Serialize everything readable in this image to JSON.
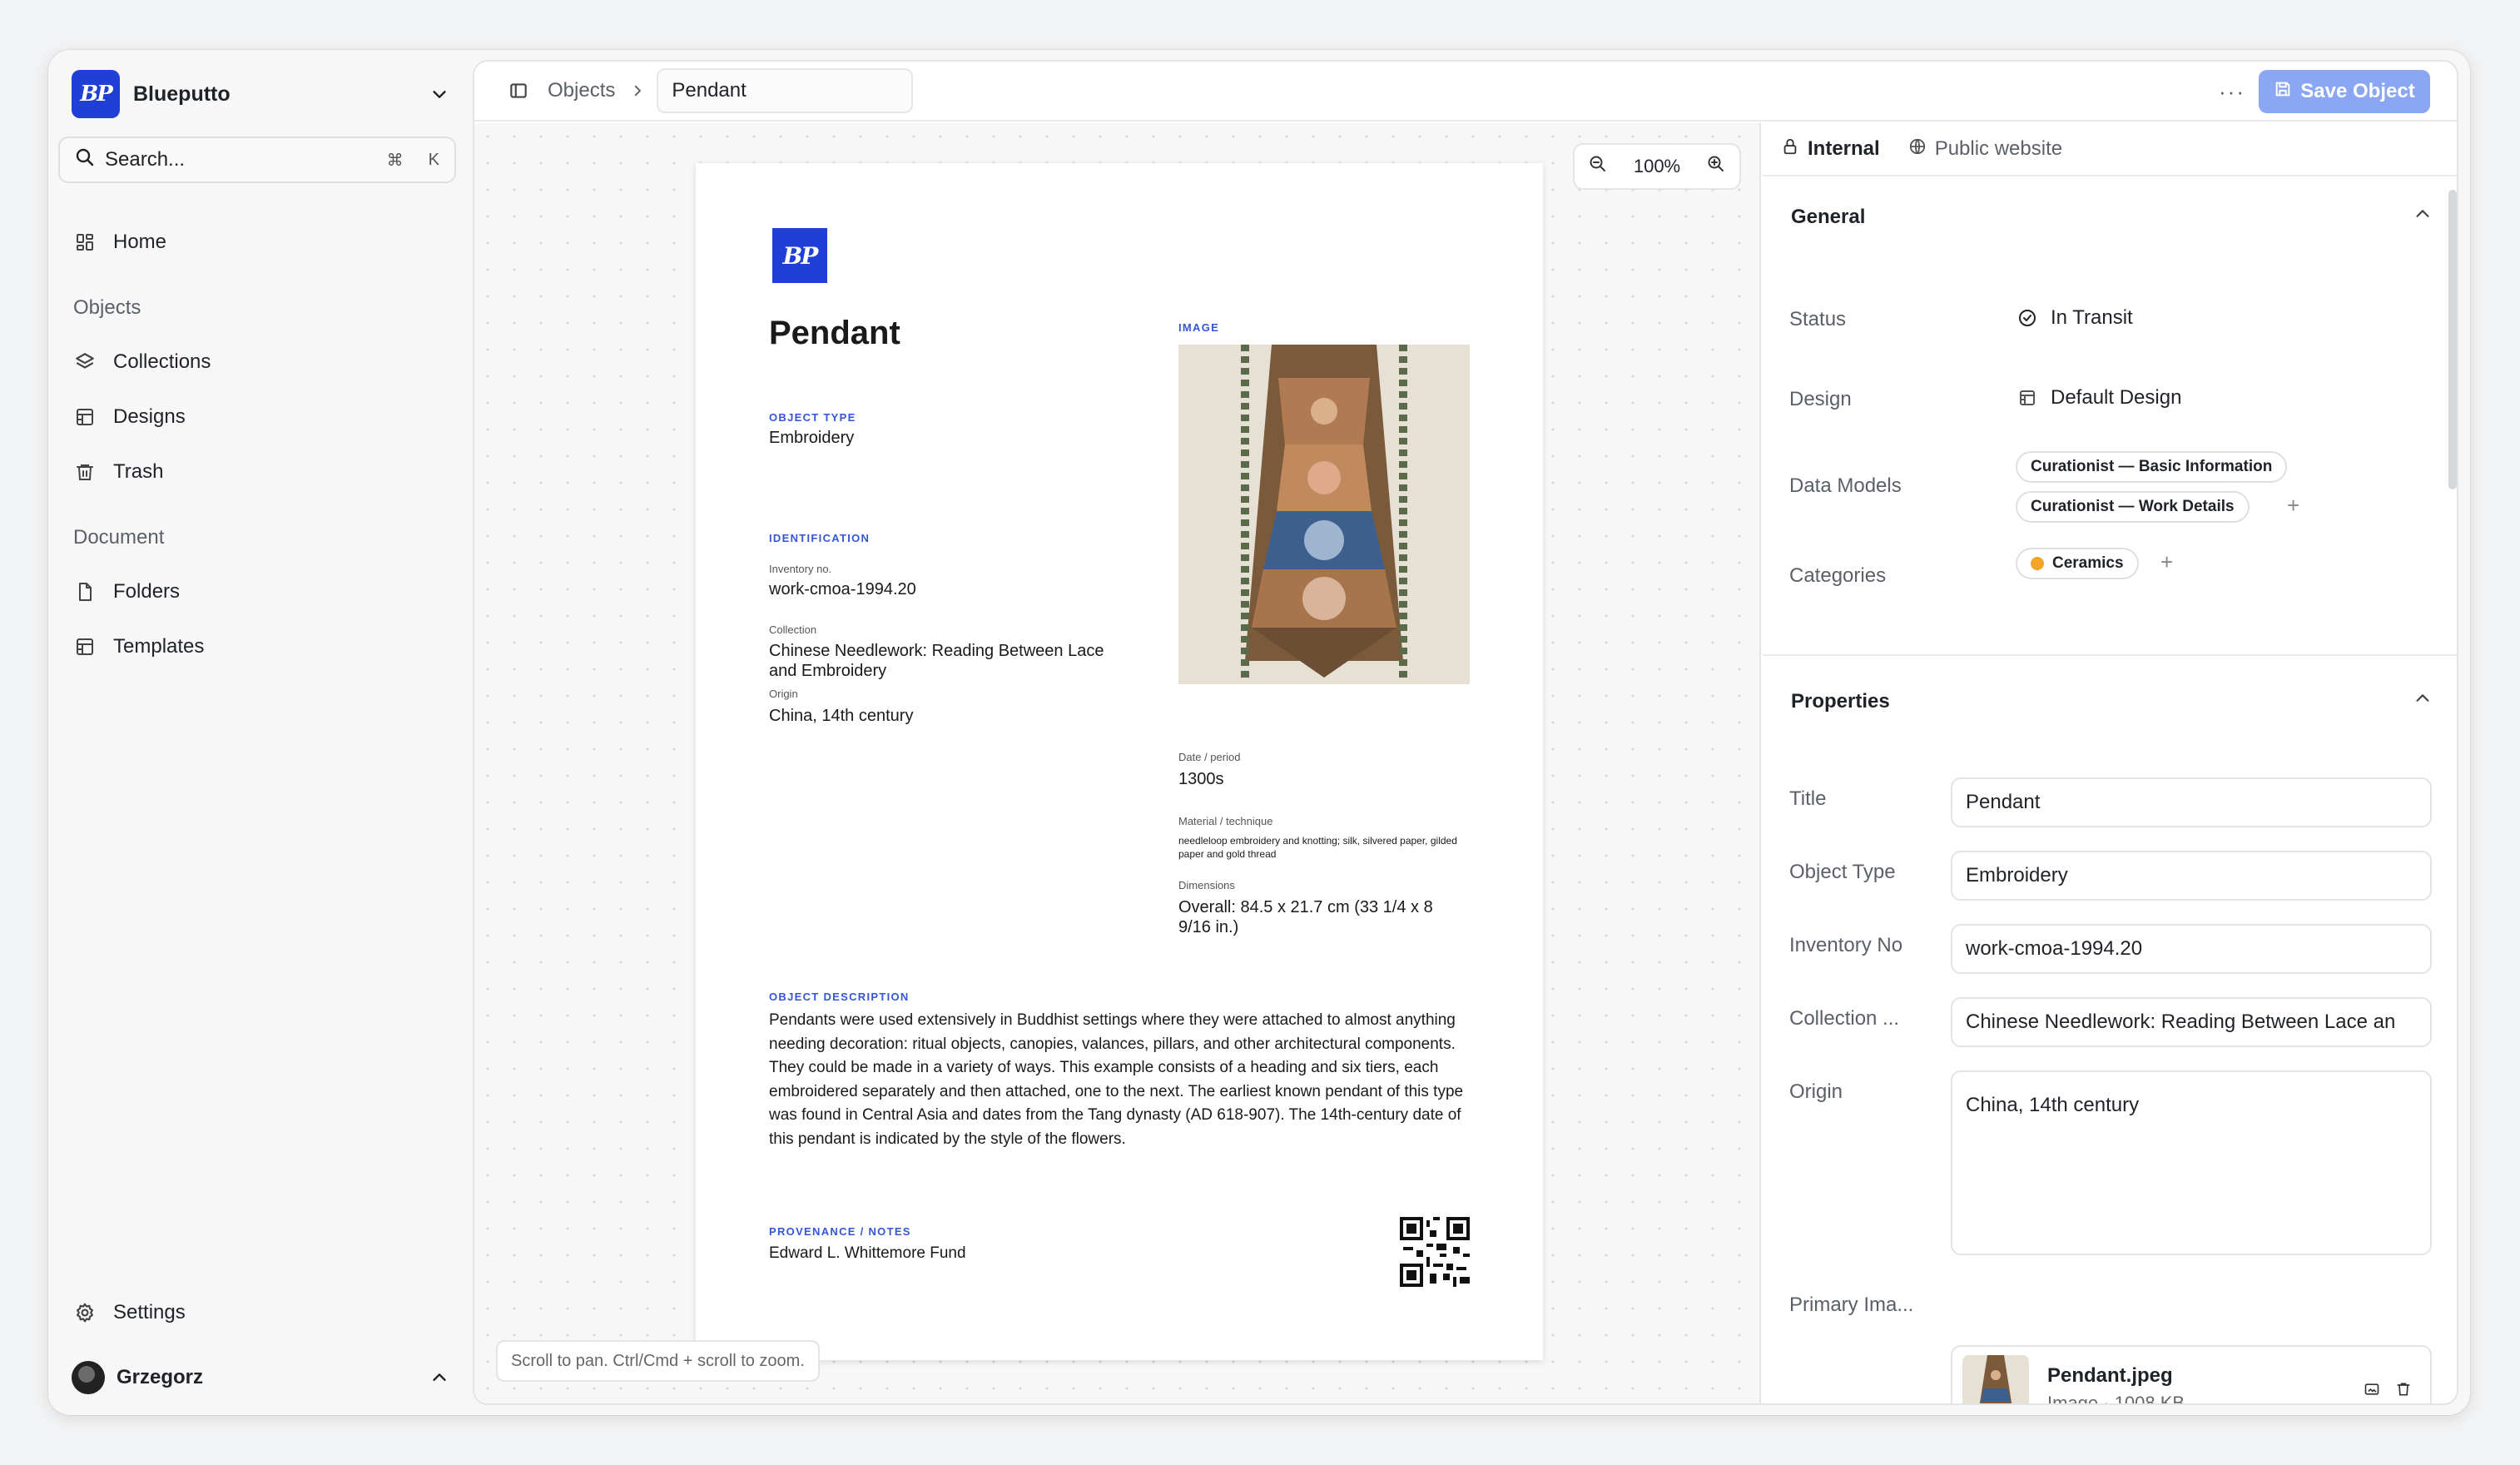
{
  "workspace": {
    "name": "Blueputto",
    "logo_text": "BP"
  },
  "search": {
    "label": "Search...",
    "shortcut_cmd": "⌘",
    "shortcut_key": "K"
  },
  "sidebar": {
    "home": "Home",
    "objects_section": "Objects",
    "collections": "Collections",
    "designs": "Designs",
    "trash": "Trash",
    "document_section": "Document",
    "folders": "Folders",
    "templates": "Templates",
    "settings": "Settings",
    "user": "Grzegorz"
  },
  "topbar": {
    "crumb_parent": "Objects",
    "crumb_current": "Pendant",
    "save_label": "Save Object"
  },
  "canvas": {
    "zoom_level": "100%",
    "hint": "Scroll to pan. Ctrl/Cmd + scroll to zoom."
  },
  "document": {
    "title": "Pendant",
    "image_label": "IMAGE",
    "object_type_label": "OBJECT TYPE",
    "object_type": "Embroidery",
    "identification_label": "IDENTIFICATION",
    "inventory_label": "Inventory no.",
    "inventory": "work-cmoa-1994.20",
    "collection_label": "Collection",
    "collection": "Chinese Needlework: Reading Between Lace and Embroidery",
    "origin_label": "Origin",
    "origin": "China, 14th century",
    "date_label": "Date / period",
    "date": "1300s",
    "material_label": "Material / technique",
    "material": "needleloop embroidery and knotting; silk, silvered paper, gilded paper and gold thread",
    "dimensions_label": "Dimensions",
    "dimensions": "Overall: 84.5 x 21.7 cm (33 1/4 x 8 9/16 in.)",
    "description_label": "OBJECT DESCRIPTION",
    "description": "Pendants were used extensively in Buddhist settings where they were attached to almost anything needing decoration: ritual objects, canopies, valances, pillars, and other architectural components. They could be made in a variety of ways. This example consists of a heading and six tiers, each embroidered separately and then attached, one to the next. The earliest known pendant of this type was found in Central Asia and dates from the Tang dynasty (AD 618-907). The 14th-century date of this pendant is indicated by the style of the flowers.",
    "provenance_label": "PROVENANCE / NOTES",
    "provenance": "Edward L. Whittemore Fund"
  },
  "inspector": {
    "tab_internal": "Internal",
    "tab_public": "Public website",
    "general_title": "General",
    "status_label": "Status",
    "status_value": "In Transit",
    "design_label": "Design",
    "design_value": "Default Design",
    "data_models_label": "Data Models",
    "data_model_1": "Curationist — Basic Information",
    "data_model_2": "Curationist — Work Details",
    "categories_label": "Categories",
    "category_1": "Ceramics",
    "category_color": "#f5a524",
    "properties_title": "Properties",
    "title_label": "Title",
    "title_value": "Pendant",
    "object_type_label": "Object Type",
    "object_type_value": "Embroidery",
    "inventory_label": "Inventory No",
    "inventory_value": "work-cmoa-1994.20",
    "collection_label": "Collection ...",
    "collection_value": "Chinese Needlework: Reading Between Lace an",
    "origin_label": "Origin",
    "origin_value": "China, 14th century",
    "primary_image_label": "Primary Ima...",
    "file_name": "Pendant.jpeg",
    "file_meta": "Image · 1008 KB"
  },
  "colors": {
    "brand": "#1f3fd6",
    "accent_label": "#3556d6",
    "save_button": "#8ba7f3"
  }
}
